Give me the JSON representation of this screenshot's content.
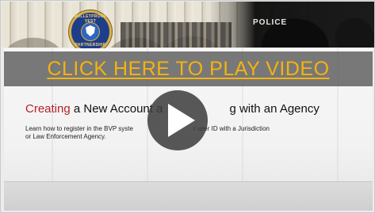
{
  "banner": {
    "logo_ring_top": "BULLETPROOF VEST",
    "logo_ring_bottom": "PARTNERSHIP",
    "vest_text": "POLICE"
  },
  "overlay": {
    "play_label": "CLICK HERE TO PLAY VIDEO"
  },
  "slide": {
    "title_red": "Creating",
    "title_a": " a New Account a",
    "title_b": "g with an Agency",
    "desc_line1_a": "Learn how to register in the BVP syste",
    "desc_line1_b": "r user ID with a Jurisdiction",
    "desc_line2": "or Law Enforcement Agency."
  },
  "colors": {
    "play_label": "#f5b30d",
    "title_accent": "#b52127",
    "badge_blue": "#1f3e8a",
    "badge_gold": "#d6b04a"
  },
  "icons": {
    "play": "play-icon",
    "logo": "bvp-badge-logo"
  }
}
